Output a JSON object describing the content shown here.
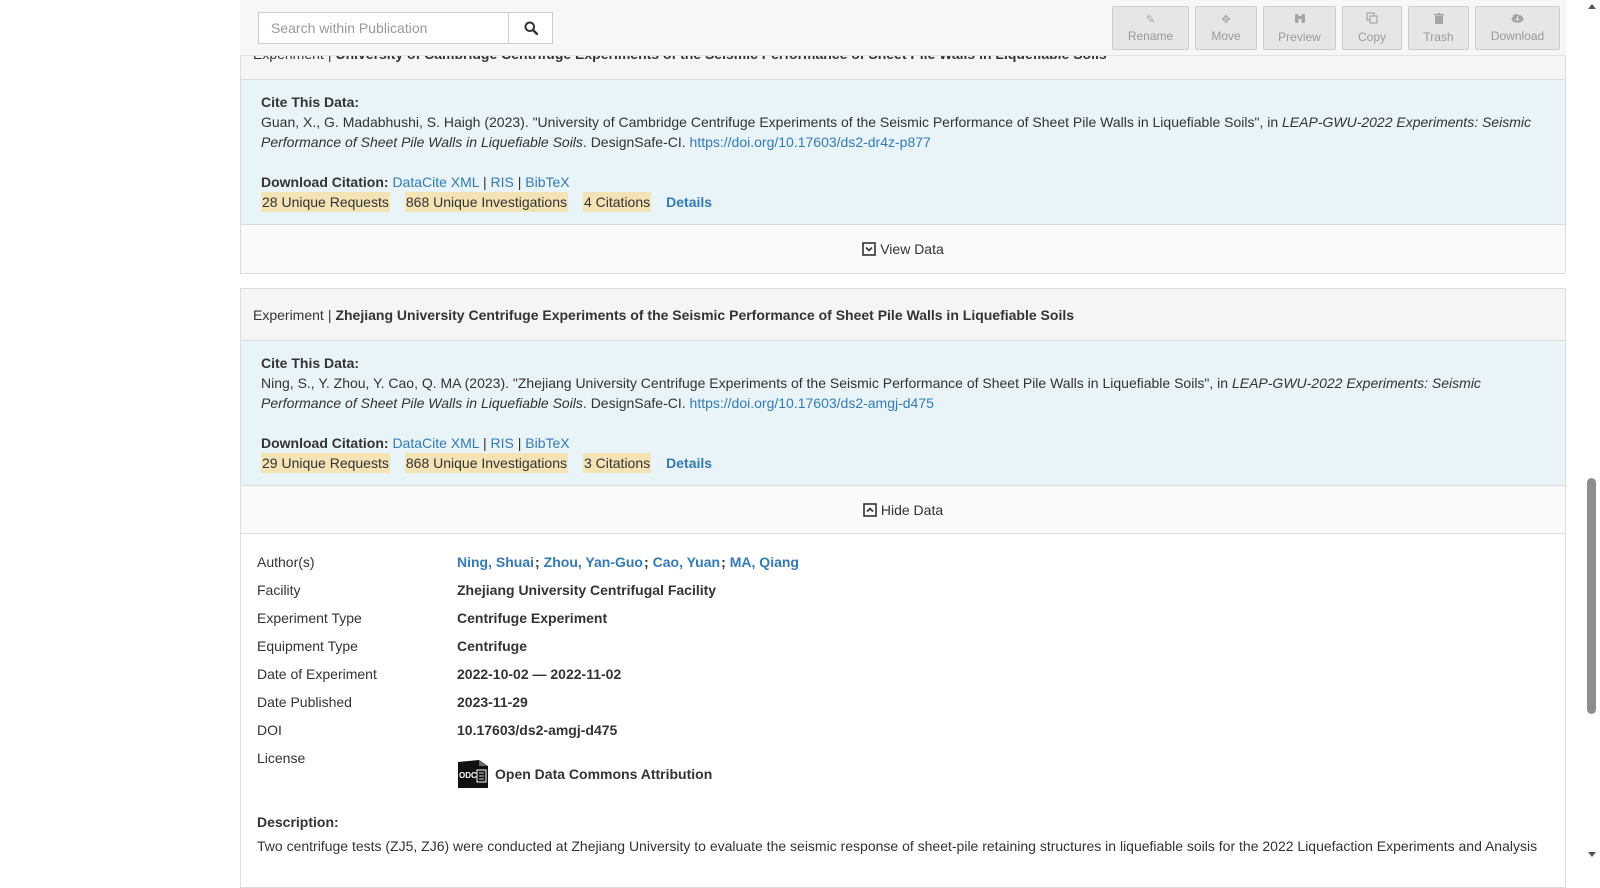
{
  "toolbar": {
    "search_placeholder": "Search within Publication",
    "buttons": [
      {
        "label": "Rename",
        "icon": "pencil-icon"
      },
      {
        "label": "Move",
        "icon": "move-icon"
      },
      {
        "label": "Preview",
        "icon": "binoculars-icon"
      },
      {
        "label": "Copy",
        "icon": "copy-icon"
      },
      {
        "label": "Trash",
        "icon": "trash-icon"
      },
      {
        "label": "Download",
        "icon": "cloud-download-icon"
      }
    ]
  },
  "exp1": {
    "type": "Experiment",
    "title": "University of Cambridge Centrifuge Experiments of the Seismic Performance of Sheet Pile Walls in Liquefiable Soils",
    "cite_label": "Cite This Data:",
    "cite_text": "Guan, X., G. Madabhushi, S. Haigh (2023). \"University of Cambridge Centrifuge Experiments of the Seismic Performance of Sheet Pile Walls in Liquefiable Soils\", in ",
    "cite_italic": "LEAP-GWU-2022 Experiments: Seismic Performance of Sheet Pile Walls in Liquefiable Soils",
    "cite_after": ". DesignSafe-CI. ",
    "doi_link": "https://doi.org/10.17603/ds2-dr4z-p877",
    "download_label": "Download Citation:",
    "formats": [
      "DataCite XML",
      "RIS",
      "BibTeX"
    ],
    "requests": "28 Unique Requests",
    "investigations": "868 Unique Investigations",
    "citations": "4 Citations",
    "details": "Details",
    "toggle": "View Data"
  },
  "exp2": {
    "type": "Experiment",
    "title": "Zhejiang University Centrifuge Experiments of the Seismic Performance of Sheet Pile Walls in Liquefiable Soils",
    "cite_label": "Cite This Data:",
    "cite_text": "Ning, S., Y. Zhou, Y. Cao, Q. MA (2023). \"Zhejiang University Centrifuge Experiments of the Seismic Performance of Sheet Pile Walls in Liquefiable Soils\", in ",
    "cite_italic": "LEAP-GWU-2022 Experiments: Seismic Performance of Sheet Pile Walls in Liquefiable Soils",
    "cite_after": ". DesignSafe-CI. ",
    "doi_link": "https://doi.org/10.17603/ds2-amgj-d475",
    "download_label": "Download Citation:",
    "formats": [
      "DataCite XML",
      "RIS",
      "BibTeX"
    ],
    "requests": "29 Unique Requests",
    "investigations": "868 Unique Investigations",
    "citations": "3 Citations",
    "details": "Details",
    "toggle": "Hide Data",
    "meta": {
      "authors_label": "Author(s)",
      "authors": [
        "Ning, Shuai",
        "Zhou, Yan-Guo",
        "Cao, Yuan",
        "MA, Qiang"
      ],
      "facility_label": "Facility",
      "facility": "Zhejiang University Centrifugal Facility",
      "exp_type_label": "Experiment Type",
      "exp_type": "Centrifuge Experiment",
      "equip_type_label": "Equipment Type",
      "equip_type": "Centrifuge",
      "date_exp_label": "Date of Experiment",
      "date_exp": "2022-10-02 — 2022-11-02",
      "date_pub_label": "Date Published",
      "date_pub": "2023-11-29",
      "doi_label": "DOI",
      "doi": "10.17603/ds2-amgj-d475",
      "license_label": "License",
      "license": "Open Data Commons Attribution",
      "license_icon_text": "ODC",
      "desc_label": "Description:",
      "desc": "Two centrifuge tests (ZJ5, ZJ6) were conducted at Zhejiang University to evaluate the seismic response of sheet-pile retaining structures in liquefiable soils for the 2022 Liquefaction Experiments and Analysis"
    }
  },
  "separator": "|"
}
